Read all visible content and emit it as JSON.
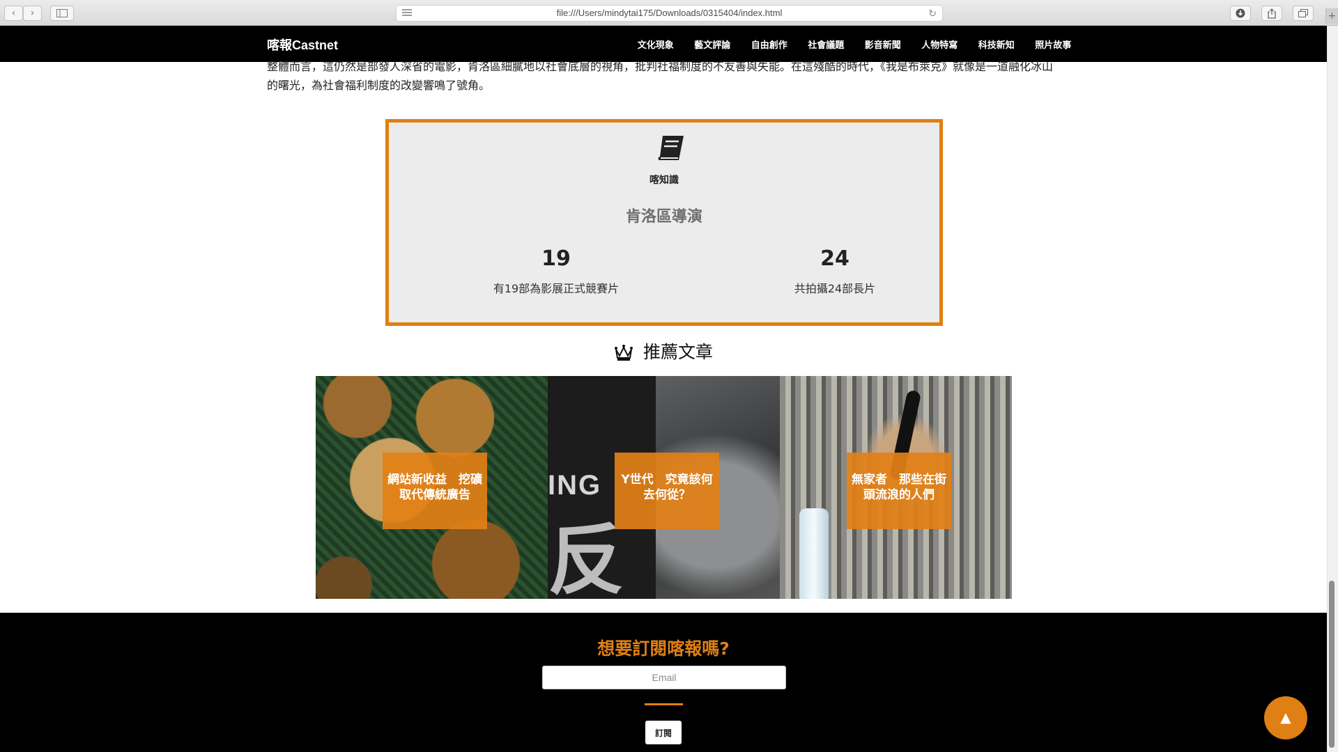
{
  "browser": {
    "url": "file:///Users/mindytai175/Downloads/0315404/index.html",
    "back": "‹",
    "forward": "›",
    "reload": "↻",
    "new_tab": "+"
  },
  "site": {
    "brand": "喀報Castnet",
    "menu": [
      "文化現象",
      "藝文評論",
      "自由創作",
      "社會議題",
      "影音新聞",
      "人物特寫",
      "科技新知",
      "照片故事"
    ]
  },
  "article": {
    "paragraph": "整體而言，這仍然是部發人深省的電影，肯洛區細膩地以社會底層的視角，批判社福制度的不友善與失能。在這殘酷的時代，《我是布萊克》就像是一道融化冰山的曙光，為社會福利制度的改變響鳴了號角。"
  },
  "knowledge": {
    "label": "喀知識",
    "title": "肯洛區導演",
    "stats": [
      {
        "number": "19",
        "text": "有19部為影展正式競賽片"
      },
      {
        "number": "24",
        "text": "共拍攝24部長片"
      }
    ],
    "accent_color": "#e07f13"
  },
  "recommended": {
    "heading": "推薦文章",
    "cards": [
      {
        "title": "網站新收益　挖礦取代傳統廣告"
      },
      {
        "title": "Y世代　究竟該何去何從？",
        "image_text_1": "ING",
        "image_text_2": "反"
      },
      {
        "title": "無家者　那些在街頭流浪的人們"
      }
    ]
  },
  "subscribe": {
    "title": "想要訂閱喀報嗎?",
    "email_placeholder": "Email",
    "button": "訂閱"
  },
  "back_to_top": "▲"
}
